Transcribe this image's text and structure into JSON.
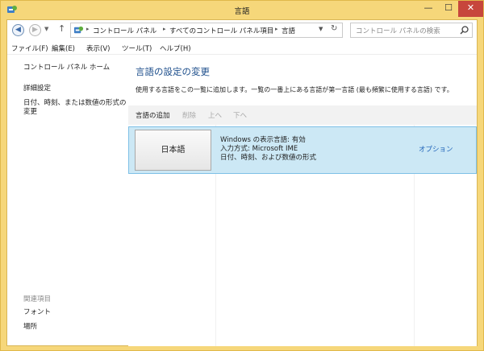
{
  "window": {
    "title": "言語",
    "controls": {
      "minimize": "—",
      "maximize": "☐",
      "close": "✕"
    }
  },
  "address": {
    "crumbs": [
      "コントロール パネル",
      "すべてのコントロール パネル項目",
      "言語"
    ],
    "separator": "▸"
  },
  "search": {
    "placeholder": "コントロール パネルの検索"
  },
  "menu": [
    "ファイル(F)",
    "編集(E)",
    "表示(V)",
    "ツール(T)",
    "ヘルプ(H)"
  ],
  "sidebar": {
    "home": "コントロール パネル ホーム",
    "advanced": "詳細設定",
    "datetime_line1": "日付、時刻、または数値の形式の",
    "datetime_line2": "変更",
    "related_header": "関連項目",
    "related": [
      "フォント",
      "場所"
    ]
  },
  "main": {
    "title": "言語の設定の変更",
    "description": "使用する言語をこの一覧に追加します。一覧の一番上にある言語が第一言語 (最も頻繁に使用する言語) です。",
    "toolbar": {
      "add": "言語の追加",
      "remove": "削除",
      "up": "上へ",
      "down": "下へ"
    },
    "languages": [
      {
        "name": "日本語",
        "line1": "Windows の表示言語: 有効",
        "line2": "入力方式: Microsoft IME",
        "line3": "日付、時刻、および数値の形式",
        "options": "オプション"
      }
    ]
  },
  "colors": {
    "title_bar": "#f6d77a",
    "close_button": "#c7463c",
    "heading": "#1e4f8c",
    "link": "#1e62b8",
    "selected_row": "#cce8f5"
  }
}
